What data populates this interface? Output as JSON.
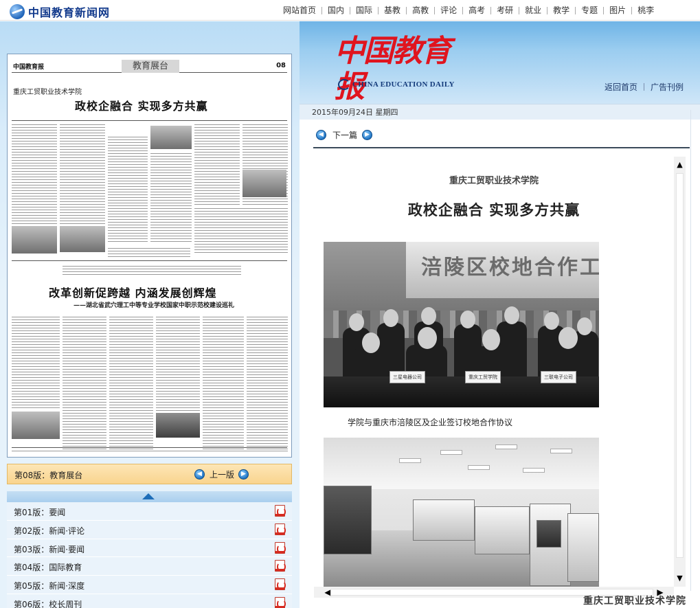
{
  "site": {
    "name": "中国教育新闻网"
  },
  "nav": [
    "网站首页",
    "国内",
    "国际",
    "基教",
    "高教",
    "评论",
    "高考",
    "考研",
    "就业",
    "教学",
    "专题",
    "图片",
    "桃李"
  ],
  "paper": {
    "name_cn": "中国教育报",
    "name_en": "CHINA EDUCATION DAILY",
    "home_link": "返回首页",
    "ads_link": "广告刊例",
    "date": "2015年09月24日  星期四"
  },
  "thumb": {
    "mini_name": "中国教育报",
    "section": "教育展台",
    "page_no": "08",
    "headline1_sub": "重庆工贸职业技术学院",
    "headline1": "政校企融合  实现多方共赢",
    "headline2": "改革创新促跨越  内涵发展创辉煌",
    "headline2_sub": "——湖北省武穴理工中等专业学校国家中职示范校建设巡礼"
  },
  "current_edition": {
    "label": "第08版：教育展台",
    "prev_label": "上一版"
  },
  "editions": [
    {
      "label": "第01版：要闻"
    },
    {
      "label": "第02版：新闻·评论"
    },
    {
      "label": "第03版：新闻·要闻"
    },
    {
      "label": "第04版：国际教育"
    },
    {
      "label": "第05版：新闻·深度"
    },
    {
      "label": "第06版：校长周刊"
    }
  ],
  "article": {
    "next_label": "下一篇",
    "subtitle": "重庆工贸职业技术学院",
    "title": "政校企融合  实现多方共赢",
    "photo1_sign": "涪陵区校地合作工",
    "photo1_caption": "学院与重庆市涪陵区及企业签订校地合作协议",
    "plates": [
      "三星电器公司",
      "重庆工贸学院",
      "三联电子公司"
    ]
  },
  "watermark": "重庆工贸职业技术学院",
  "colors": {
    "brand_red": "#e0141e",
    "navy": "#133a7a",
    "banner_blue": "#6fb4e6",
    "edition_orange": "#f9d48e"
  }
}
